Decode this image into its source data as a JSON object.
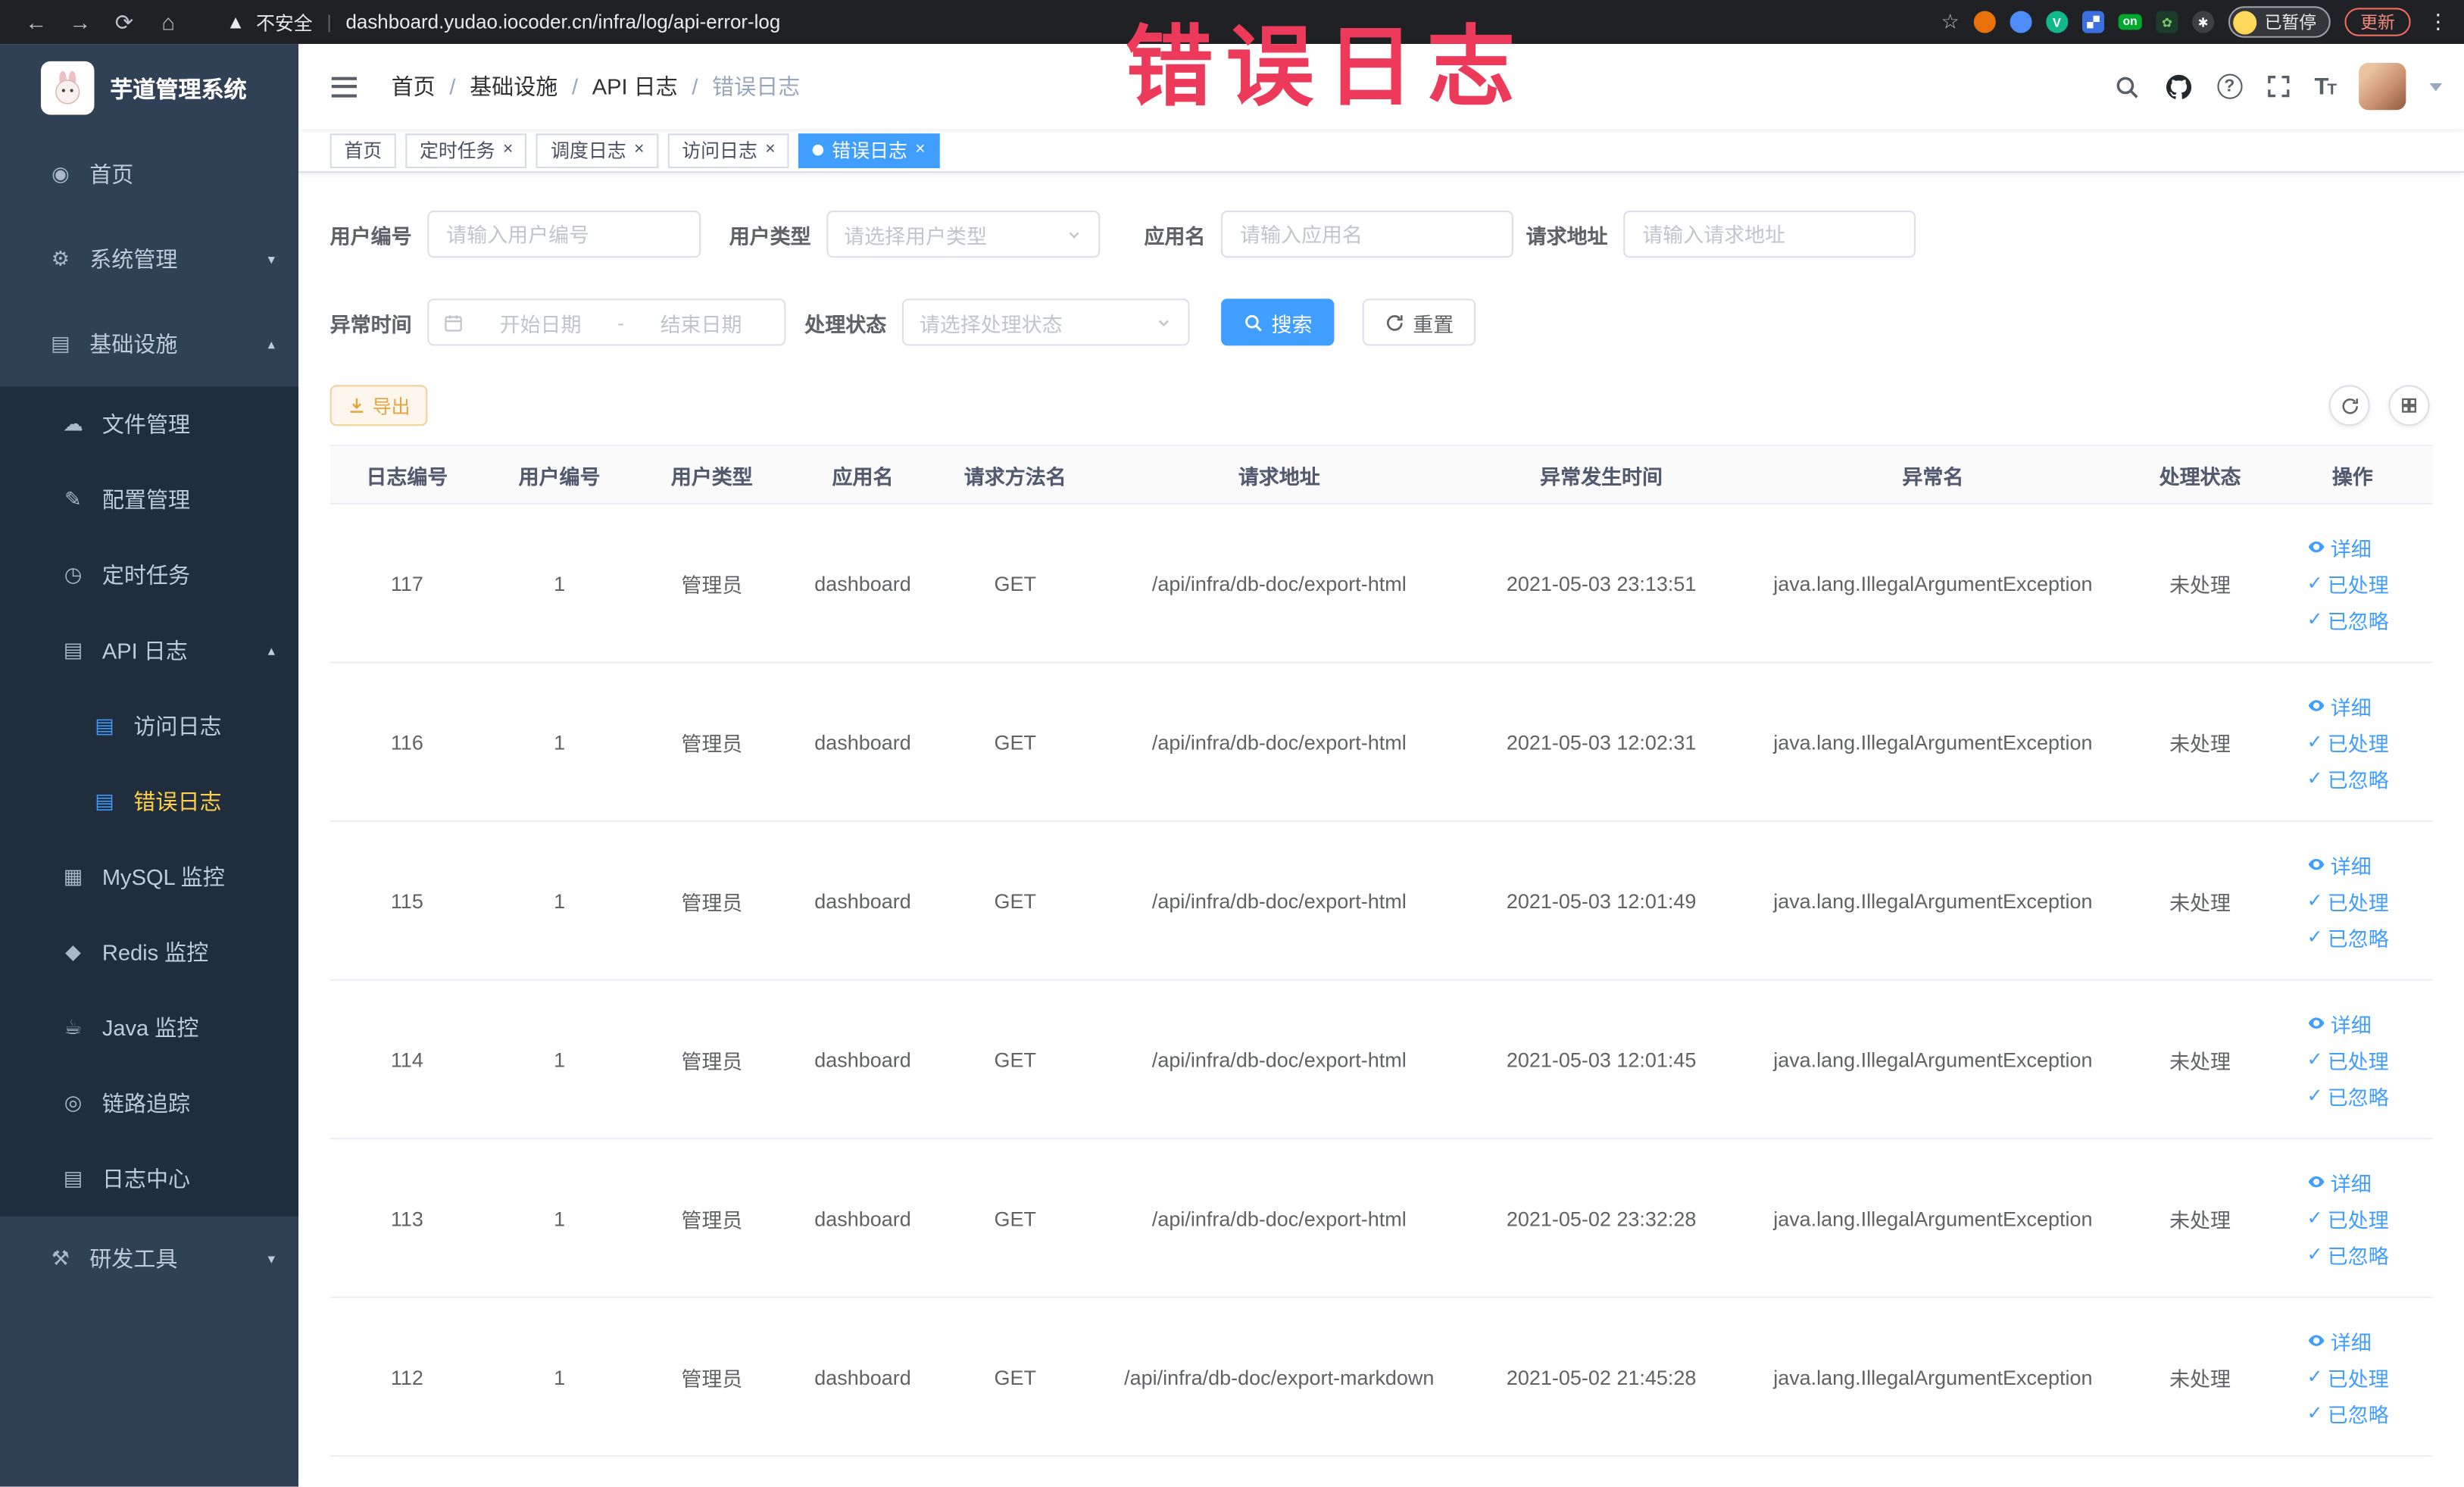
{
  "browser": {
    "security": "不安全",
    "url": "dashboard.yudao.iocoder.cn/infra/log/api-error-log",
    "ext_on": "on",
    "paused": "已暂停",
    "update": "更新"
  },
  "annotation": {
    "text": "错误日志"
  },
  "sidebar": {
    "title": "芋道管理系统",
    "items": [
      {
        "label": "首页"
      },
      {
        "label": "系统管理"
      },
      {
        "label": "基础设施"
      },
      {
        "label": "文件管理"
      },
      {
        "label": "配置管理"
      },
      {
        "label": "定时任务"
      },
      {
        "label": "API 日志"
      },
      {
        "label": "访问日志"
      },
      {
        "label": "错误日志"
      },
      {
        "label": "MySQL 监控"
      },
      {
        "label": "Redis 监控"
      },
      {
        "label": "Java 监控"
      },
      {
        "label": "链路追踪"
      },
      {
        "label": "日志中心"
      },
      {
        "label": "研发工具"
      }
    ]
  },
  "breadcrumb": {
    "items": [
      "首页",
      "基础设施",
      "API 日志",
      "错误日志"
    ]
  },
  "tabs": [
    {
      "label": "首页"
    },
    {
      "label": "定时任务"
    },
    {
      "label": "调度日志"
    },
    {
      "label": "访问日志"
    },
    {
      "label": "错误日志"
    }
  ],
  "filters": {
    "user_id": {
      "label": "用户编号",
      "placeholder": "请输入用户编号"
    },
    "user_type": {
      "label": "用户类型",
      "placeholder": "请选择用户类型"
    },
    "app_name": {
      "label": "应用名",
      "placeholder": "请输入应用名"
    },
    "request_url": {
      "label": "请求地址",
      "placeholder": "请输入请求地址"
    },
    "exception_time": {
      "label": "异常时间",
      "start": "开始日期",
      "separator": "-",
      "end": "结束日期"
    },
    "process_status": {
      "label": "处理状态",
      "placeholder": "请选择处理状态"
    },
    "search": "搜索",
    "reset": "重置"
  },
  "toolbar": {
    "export": "导出"
  },
  "table": {
    "columns": [
      "日志编号",
      "用户编号",
      "用户类型",
      "应用名",
      "请求方法名",
      "请求地址",
      "异常发生时间",
      "异常名",
      "处理状态",
      "操作"
    ],
    "actions": {
      "detail": "详细",
      "processed": "已处理",
      "ignored": "已忽略"
    },
    "rows": [
      {
        "id": "117",
        "user_id": "1",
        "user_type": "管理员",
        "app": "dashboard",
        "method": "GET",
        "url": "/api/infra/db-doc/export-html",
        "time": "2021-05-03 23:13:51",
        "exception": "java.lang.IllegalArgumentException",
        "status": "未处理"
      },
      {
        "id": "116",
        "user_id": "1",
        "user_type": "管理员",
        "app": "dashboard",
        "method": "GET",
        "url": "/api/infra/db-doc/export-html",
        "time": "2021-05-03 12:02:31",
        "exception": "java.lang.IllegalArgumentException",
        "status": "未处理"
      },
      {
        "id": "115",
        "user_id": "1",
        "user_type": "管理员",
        "app": "dashboard",
        "method": "GET",
        "url": "/api/infra/db-doc/export-html",
        "time": "2021-05-03 12:01:49",
        "exception": "java.lang.IllegalArgumentException",
        "status": "未处理"
      },
      {
        "id": "114",
        "user_id": "1",
        "user_type": "管理员",
        "app": "dashboard",
        "method": "GET",
        "url": "/api/infra/db-doc/export-html",
        "time": "2021-05-03 12:01:45",
        "exception": "java.lang.IllegalArgumentException",
        "status": "未处理"
      },
      {
        "id": "113",
        "user_id": "1",
        "user_type": "管理员",
        "app": "dashboard",
        "method": "GET",
        "url": "/api/infra/db-doc/export-html",
        "time": "2021-05-02 23:32:28",
        "exception": "java.lang.IllegalArgumentException",
        "status": "未处理"
      },
      {
        "id": "112",
        "user_id": "1",
        "user_type": "管理员",
        "app": "dashboard",
        "method": "GET",
        "url": "/api/infra/db-doc/export-markdown",
        "time": "2021-05-02 21:45:28",
        "exception": "java.lang.IllegalArgumentException",
        "status": "未处理"
      }
    ]
  }
}
